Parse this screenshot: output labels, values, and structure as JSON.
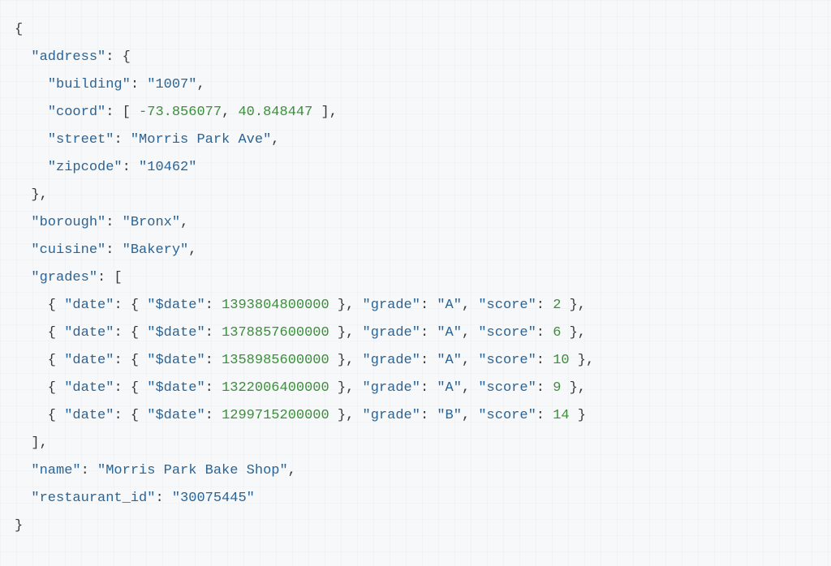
{
  "code": {
    "lines": [
      [
        {
          "t": "{",
          "c": "p"
        }
      ],
      [
        {
          "t": "  ",
          "c": "p"
        },
        {
          "t": "\"address\"",
          "c": "k"
        },
        {
          "t": ": {",
          "c": "p"
        }
      ],
      [
        {
          "t": "    ",
          "c": "p"
        },
        {
          "t": "\"building\"",
          "c": "k"
        },
        {
          "t": ": ",
          "c": "p"
        },
        {
          "t": "\"1007\"",
          "c": "s"
        },
        {
          "t": ",",
          "c": "p"
        }
      ],
      [
        {
          "t": "    ",
          "c": "p"
        },
        {
          "t": "\"coord\"",
          "c": "k"
        },
        {
          "t": ": [ ",
          "c": "p"
        },
        {
          "t": "-73.856077",
          "c": "n"
        },
        {
          "t": ", ",
          "c": "p"
        },
        {
          "t": "40.848447",
          "c": "n"
        },
        {
          "t": " ],",
          "c": "p"
        }
      ],
      [
        {
          "t": "    ",
          "c": "p"
        },
        {
          "t": "\"street\"",
          "c": "k"
        },
        {
          "t": ": ",
          "c": "p"
        },
        {
          "t": "\"Morris Park Ave\"",
          "c": "s"
        },
        {
          "t": ",",
          "c": "p"
        }
      ],
      [
        {
          "t": "    ",
          "c": "p"
        },
        {
          "t": "\"zipcode\"",
          "c": "k"
        },
        {
          "t": ": ",
          "c": "p"
        },
        {
          "t": "\"10462\"",
          "c": "s"
        }
      ],
      [
        {
          "t": "  },",
          "c": "p"
        }
      ],
      [
        {
          "t": "  ",
          "c": "p"
        },
        {
          "t": "\"borough\"",
          "c": "k"
        },
        {
          "t": ": ",
          "c": "p"
        },
        {
          "t": "\"Bronx\"",
          "c": "s"
        },
        {
          "t": ",",
          "c": "p"
        }
      ],
      [
        {
          "t": "  ",
          "c": "p"
        },
        {
          "t": "\"cuisine\"",
          "c": "k"
        },
        {
          "t": ": ",
          "c": "p"
        },
        {
          "t": "\"Bakery\"",
          "c": "s"
        },
        {
          "t": ",",
          "c": "p"
        }
      ],
      [
        {
          "t": "  ",
          "c": "p"
        },
        {
          "t": "\"grades\"",
          "c": "k"
        },
        {
          "t": ": [",
          "c": "p"
        }
      ],
      [
        {
          "t": "    { ",
          "c": "p"
        },
        {
          "t": "\"date\"",
          "c": "k"
        },
        {
          "t": ": { ",
          "c": "p"
        },
        {
          "t": "\"$date\"",
          "c": "k"
        },
        {
          "t": ": ",
          "c": "p"
        },
        {
          "t": "1393804800000",
          "c": "n"
        },
        {
          "t": " }, ",
          "c": "p"
        },
        {
          "t": "\"grade\"",
          "c": "k"
        },
        {
          "t": ": ",
          "c": "p"
        },
        {
          "t": "\"A\"",
          "c": "s"
        },
        {
          "t": ", ",
          "c": "p"
        },
        {
          "t": "\"score\"",
          "c": "k"
        },
        {
          "t": ": ",
          "c": "p"
        },
        {
          "t": "2",
          "c": "n"
        },
        {
          "t": " },",
          "c": "p"
        }
      ],
      [
        {
          "t": "    { ",
          "c": "p"
        },
        {
          "t": "\"date\"",
          "c": "k"
        },
        {
          "t": ": { ",
          "c": "p"
        },
        {
          "t": "\"$date\"",
          "c": "k"
        },
        {
          "t": ": ",
          "c": "p"
        },
        {
          "t": "1378857600000",
          "c": "n"
        },
        {
          "t": " }, ",
          "c": "p"
        },
        {
          "t": "\"grade\"",
          "c": "k"
        },
        {
          "t": ": ",
          "c": "p"
        },
        {
          "t": "\"A\"",
          "c": "s"
        },
        {
          "t": ", ",
          "c": "p"
        },
        {
          "t": "\"score\"",
          "c": "k"
        },
        {
          "t": ": ",
          "c": "p"
        },
        {
          "t": "6",
          "c": "n"
        },
        {
          "t": " },",
          "c": "p"
        }
      ],
      [
        {
          "t": "    { ",
          "c": "p"
        },
        {
          "t": "\"date\"",
          "c": "k"
        },
        {
          "t": ": { ",
          "c": "p"
        },
        {
          "t": "\"$date\"",
          "c": "k"
        },
        {
          "t": ": ",
          "c": "p"
        },
        {
          "t": "1358985600000",
          "c": "n"
        },
        {
          "t": " }, ",
          "c": "p"
        },
        {
          "t": "\"grade\"",
          "c": "k"
        },
        {
          "t": ": ",
          "c": "p"
        },
        {
          "t": "\"A\"",
          "c": "s"
        },
        {
          "t": ", ",
          "c": "p"
        },
        {
          "t": "\"score\"",
          "c": "k"
        },
        {
          "t": ": ",
          "c": "p"
        },
        {
          "t": "10",
          "c": "n"
        },
        {
          "t": " },",
          "c": "p"
        }
      ],
      [
        {
          "t": "    { ",
          "c": "p"
        },
        {
          "t": "\"date\"",
          "c": "k"
        },
        {
          "t": ": { ",
          "c": "p"
        },
        {
          "t": "\"$date\"",
          "c": "k"
        },
        {
          "t": ": ",
          "c": "p"
        },
        {
          "t": "1322006400000",
          "c": "n"
        },
        {
          "t": " }, ",
          "c": "p"
        },
        {
          "t": "\"grade\"",
          "c": "k"
        },
        {
          "t": ": ",
          "c": "p"
        },
        {
          "t": "\"A\"",
          "c": "s"
        },
        {
          "t": ", ",
          "c": "p"
        },
        {
          "t": "\"score\"",
          "c": "k"
        },
        {
          "t": ": ",
          "c": "p"
        },
        {
          "t": "9",
          "c": "n"
        },
        {
          "t": " },",
          "c": "p"
        }
      ],
      [
        {
          "t": "    { ",
          "c": "p"
        },
        {
          "t": "\"date\"",
          "c": "k"
        },
        {
          "t": ": { ",
          "c": "p"
        },
        {
          "t": "\"$date\"",
          "c": "k"
        },
        {
          "t": ": ",
          "c": "p"
        },
        {
          "t": "1299715200000",
          "c": "n"
        },
        {
          "t": " }, ",
          "c": "p"
        },
        {
          "t": "\"grade\"",
          "c": "k"
        },
        {
          "t": ": ",
          "c": "p"
        },
        {
          "t": "\"B\"",
          "c": "s"
        },
        {
          "t": ", ",
          "c": "p"
        },
        {
          "t": "\"score\"",
          "c": "k"
        },
        {
          "t": ": ",
          "c": "p"
        },
        {
          "t": "14",
          "c": "n"
        },
        {
          "t": " }",
          "c": "p"
        }
      ],
      [
        {
          "t": "  ],",
          "c": "p"
        }
      ],
      [
        {
          "t": "  ",
          "c": "p"
        },
        {
          "t": "\"name\"",
          "c": "k"
        },
        {
          "t": ": ",
          "c": "p"
        },
        {
          "t": "\"Morris Park Bake Shop\"",
          "c": "s"
        },
        {
          "t": ",",
          "c": "p"
        }
      ],
      [
        {
          "t": "  ",
          "c": "p"
        },
        {
          "t": "\"restaurant_id\"",
          "c": "k"
        },
        {
          "t": ": ",
          "c": "p"
        },
        {
          "t": "\"30075445\"",
          "c": "s"
        }
      ],
      [
        {
          "t": "}",
          "c": "p"
        }
      ]
    ]
  }
}
